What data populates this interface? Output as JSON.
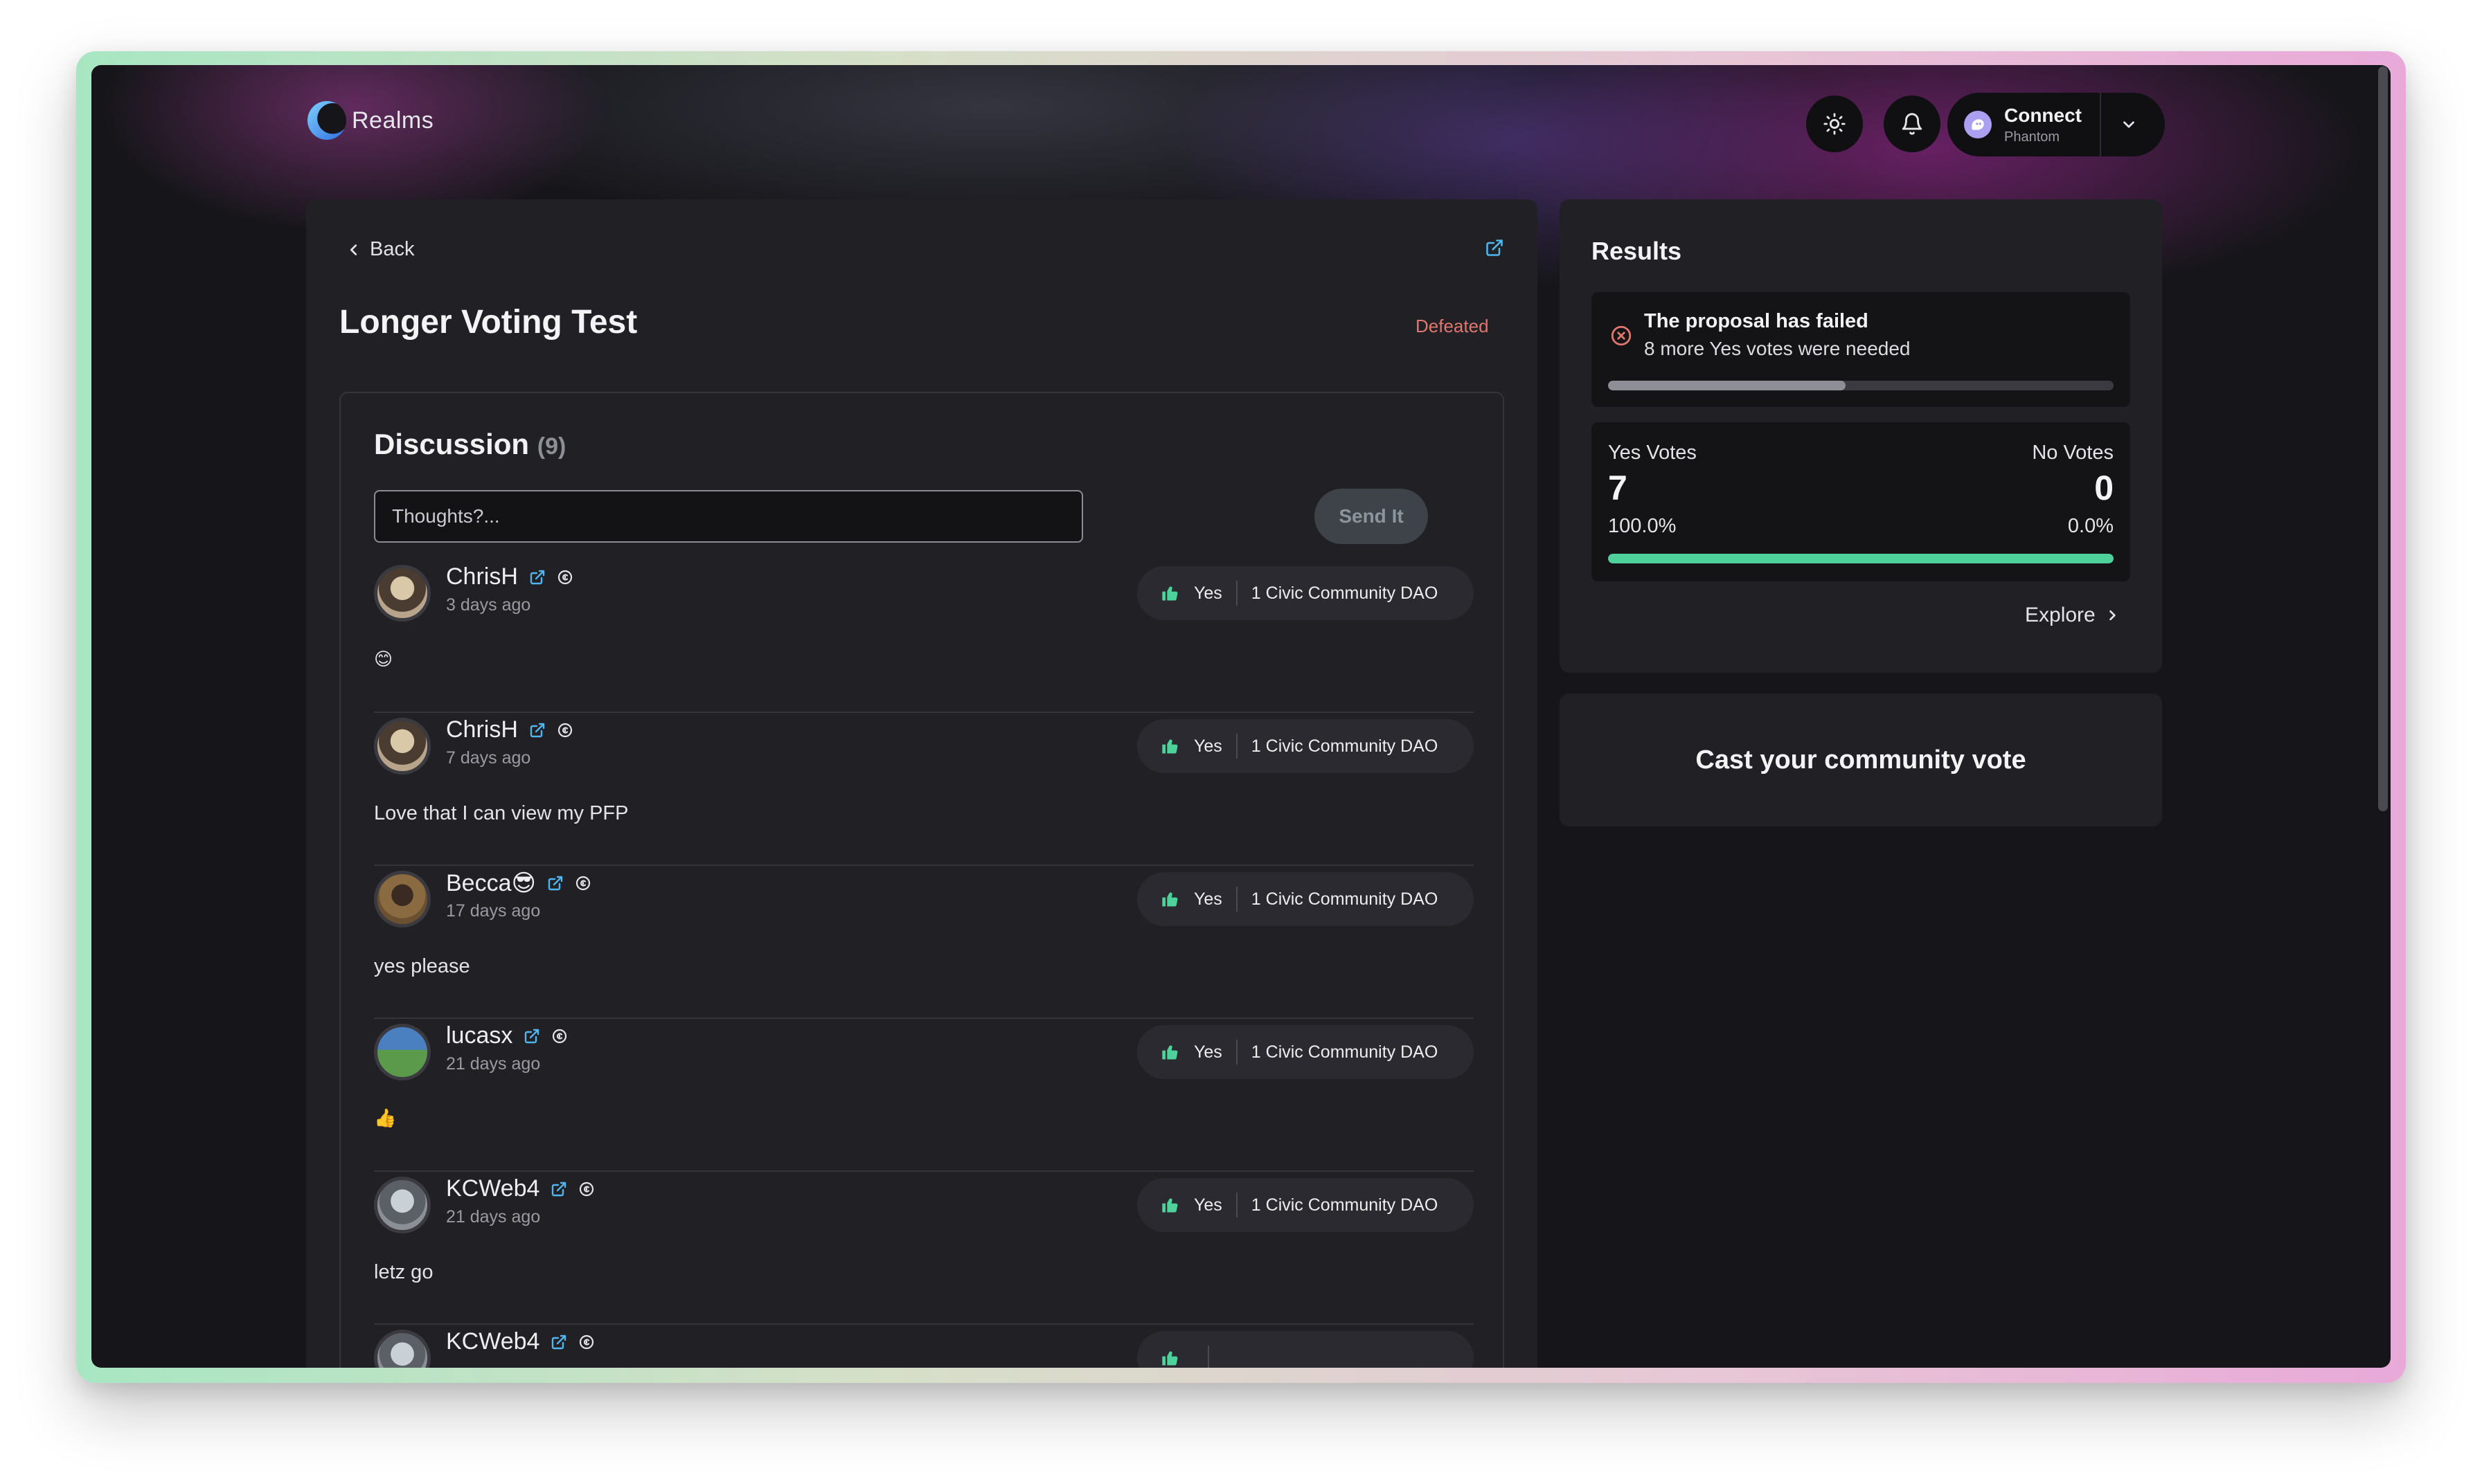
{
  "header": {
    "logo_text": "Realms",
    "theme_icon": "sun-icon",
    "notifications_icon": "bell-icon",
    "wallet": {
      "title": "Connect",
      "subtitle": "Phantom",
      "dropdown_icon": "chevron-down-icon"
    }
  },
  "proposal": {
    "back_label": "Back",
    "title": "Longer Voting Test",
    "status": "Defeated",
    "status_color": "#e0776f"
  },
  "discussion": {
    "title": "Discussion",
    "count": "(9)",
    "input_placeholder": "Thoughts?...",
    "send_label": "Send It",
    "comments": [
      {
        "author": "ChrisH",
        "time": "3 days ago",
        "body": "😊",
        "vote": "Yes",
        "dao": "1 Civic Community DAO"
      },
      {
        "author": "ChrisH",
        "time": "7 days ago",
        "body": "Love that I can view my PFP",
        "vote": "Yes",
        "dao": "1 Civic Community DAO"
      },
      {
        "author": "Becca😎",
        "time": "17 days ago",
        "body": "yes please",
        "vote": "Yes",
        "dao": "1 Civic Community DAO"
      },
      {
        "author": "lucasx",
        "time": "21 days ago",
        "body": "👍",
        "vote": "Yes",
        "dao": "1 Civic Community DAO"
      },
      {
        "author": "KCWeb4",
        "time": "21 days ago",
        "body": "letz go",
        "vote": "Yes",
        "dao": "1 Civic Community DAO"
      },
      {
        "author": "KCWeb4",
        "time": "",
        "body": "",
        "vote": "",
        "dao": ""
      }
    ]
  },
  "results": {
    "title": "Results",
    "fail_title": "The proposal has failed",
    "fail_subtitle": "8 more Yes votes were needed",
    "quorum_progress": 0.47,
    "yes_label": "Yes Votes",
    "no_label": "No Votes",
    "yes_count": "7",
    "no_count": "0",
    "yes_pct": "100.0%",
    "no_pct": "0.0%",
    "yes_share": 1.0,
    "explore_label": "Explore",
    "accent_green": "#4fd19b",
    "fail_red": "#e0776f"
  },
  "cast": {
    "label": "Cast your community vote"
  }
}
